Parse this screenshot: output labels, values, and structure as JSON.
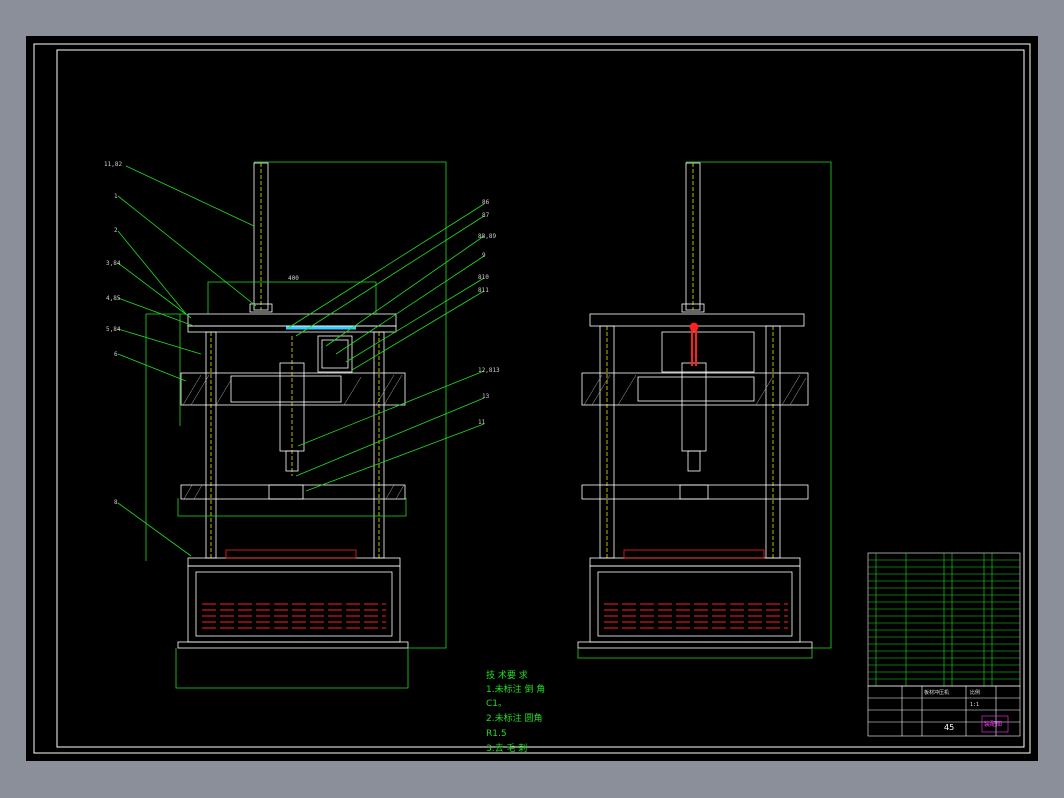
{
  "drawing": {
    "callouts_left": [
      "11,82",
      "1",
      "2",
      "3,84",
      "4,85",
      "5,84",
      "6",
      "8"
    ],
    "callouts_right": [
      "86",
      "87",
      "88,89",
      "9",
      "810",
      "811",
      "12,813",
      "13",
      "11"
    ],
    "dims": {
      "top_width": "400",
      "bottom_width": "",
      "base_width": "",
      "height_right": "",
      "height_left": ""
    }
  },
  "notes": {
    "heading": "技 术要 求",
    "line1": "1.未标注 倒 角",
    "line2": "C1。",
    "line3": "2.未标注 圆角",
    "line4": "R1.5",
    "line5": "3.去 毛 刺"
  },
  "title_block": {
    "sheet_no": "45",
    "scale_label": "比例",
    "scale_value": "1:1",
    "drawing_name": "板材冲压机",
    "stamp": "装配图"
  },
  "colors": {
    "frame": "#ffffff",
    "green": "#22dd22",
    "yellow": "#e6e600",
    "red": "#ff2020",
    "cyan": "#33ccff",
    "magenta": "#ff33ff"
  }
}
